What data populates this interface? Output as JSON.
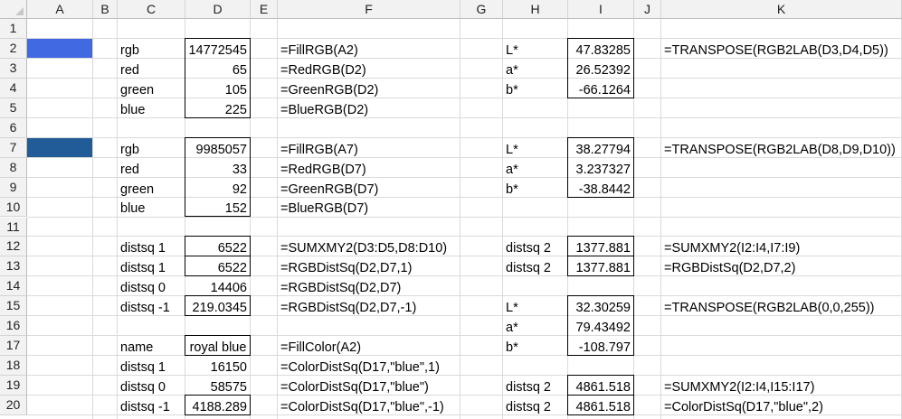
{
  "columns": [
    "A",
    "B",
    "C",
    "D",
    "E",
    "F",
    "G",
    "H",
    "I",
    "J",
    "K"
  ],
  "rows": [
    "1",
    "2",
    "3",
    "4",
    "5",
    "6",
    "7",
    "8",
    "9",
    "10",
    "11",
    "12",
    "13",
    "14",
    "15",
    "16",
    "17",
    "18",
    "19",
    "20"
  ],
  "fill_colors": {
    "A2": "#4169e1",
    "A7": "#215c98"
  },
  "cells": {
    "C2": "rgb",
    "D2": "14772545",
    "F2": "=FillRGB(A2)",
    "H2": "L*",
    "I2": "47.83285",
    "K2": "=TRANSPOSE(RGB2LAB(D3,D4,D5))",
    "C3": "red",
    "D3": "65",
    "F3": "=RedRGB(D2)",
    "H3": "a*",
    "I3": "26.52392",
    "C4": "green",
    "D4": "105",
    "F4": "=GreenRGB(D2)",
    "H4": "b*",
    "I4": "-66.1264",
    "C5": "blue",
    "D5": "225",
    "F5": "=BlueRGB(D2)",
    "C7": "rgb",
    "D7": "9985057",
    "F7": "=FillRGB(A7)",
    "H7": "L*",
    "I7": "38.27794",
    "K7": "=TRANSPOSE(RGB2LAB(D8,D9,D10))",
    "C8": "red",
    "D8": "33",
    "F8": "=RedRGB(D7)",
    "H8": "a*",
    "I8": "3.237327",
    "C9": "green",
    "D9": "92",
    "F9": "=GreenRGB(D7)",
    "H9": "b*",
    "I9": "-38.8442",
    "C10": "blue",
    "D10": "152",
    "F10": "=BlueRGB(D7)",
    "C12": "distsq 1",
    "D12": "6522",
    "F12": "=SUMXMY2(D3:D5,D8:D10)",
    "H12": "distsq 2",
    "I12": "1377.881",
    "K12": "=SUMXMY2(I2:I4,I7:I9)",
    "C13": "distsq 1",
    "D13": "6522",
    "F13": "=RGBDistSq(D2,D7,1)",
    "H13": "distsq 2",
    "I13": "1377.881",
    "K13": "=RGBDistSq(D2,D7,2)",
    "C14": "distsq 0",
    "D14": "14406",
    "F14": "=RGBDistSq(D2,D7)",
    "C15": "distsq -1",
    "D15": "219.0345",
    "F15": "=RGBDistSq(D2,D7,-1)",
    "H15": "L*",
    "I15": "32.30259",
    "K15": "=TRANSPOSE(RGB2LAB(0,0,255))",
    "H16": "a*",
    "I16": "79.43492",
    "C17": "name",
    "D17": "royal blue",
    "F17": "=FillColor(A2)",
    "H17": "b*",
    "I17": "-108.797",
    "C18": "distsq 1",
    "D18": "16150",
    "F18": "=ColorDistSq(D17,\"blue\",1)",
    "C19": "distsq 0",
    "D19": "58575",
    "F19": "=ColorDistSq(D17,\"blue\")",
    "H19": "distsq 2",
    "I19": "4861.518",
    "K19": "=SUMXMY2(I2:I4,I15:I17)",
    "C20": "distsq -1",
    "D20": "4188.289",
    "F20": "=ColorDistSq(D17,\"blue\",-1)",
    "H20": "distsq 2",
    "I20": "4861.518",
    "K20": "=ColorDistSq(D17,\"blue\",2)"
  }
}
